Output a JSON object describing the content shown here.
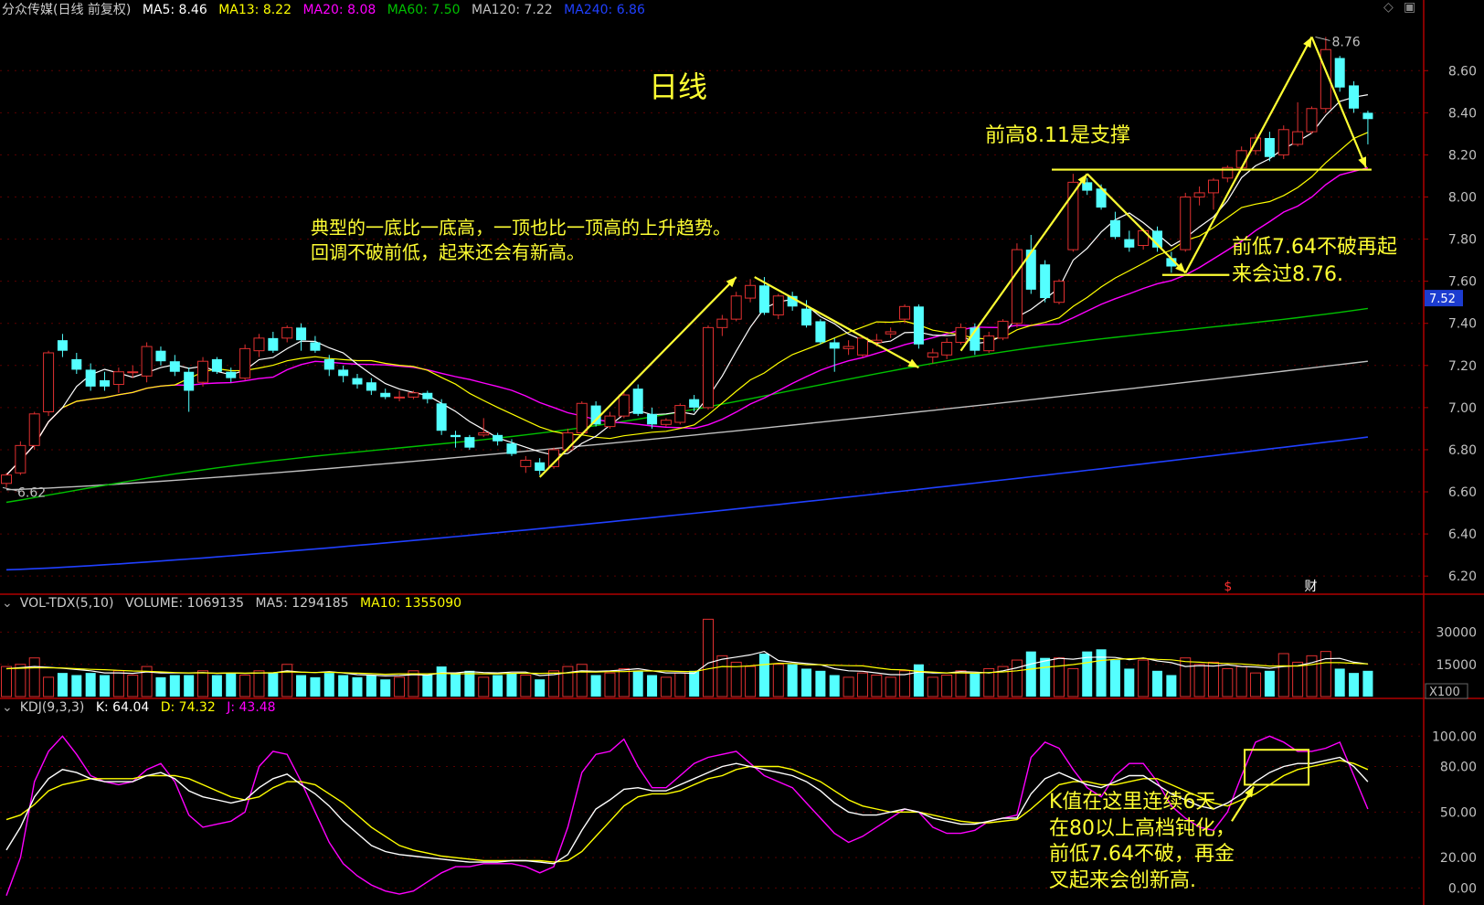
{
  "colors": {
    "background": "#000000",
    "up": "#e03030",
    "down": "#54ffff",
    "ma5": "#ffffff",
    "ma13": "#ffff00",
    "ma20": "#ff00ff",
    "ma60": "#00c000",
    "ma120": "#c0c0c0",
    "ma240": "#2040ff",
    "annotation": "#ffff33",
    "axis": "#b00000"
  },
  "header": {
    "title": "分众传媒(日线 前复权)",
    "ma5": "MA5: 8.46",
    "ma13": "MA13: 8.22",
    "ma20": "MA20: 8.08",
    "ma60": "MA60: 7.50",
    "ma120": "MA120: 7.22",
    "ma240": "MA240: 6.86"
  },
  "vol_header": {
    "name": "VOL-TDX(5,10)",
    "volume": "VOLUME: 1069135",
    "ma5": "MA5: 1294185",
    "ma10": "MA10: 1355090"
  },
  "kdj_header": {
    "name": "KDJ(9,3,3)",
    "k": "K: 64.04",
    "d": "D: 74.32",
    "j": "J: 43.48"
  },
  "annotations": {
    "period": "日线",
    "trend_line1": "典型的一底比一底高，一顶也比一顶高的上升趋势。",
    "trend_line2": "回调不破前低，起来还会有新高。",
    "support": "前高8.11是支撑",
    "low_line1": "前低7.64不破再起",
    "low_line2": "来会过8.76.",
    "kdj_line1": "K值在这里连续6天",
    "kdj_line2": "在80以上高档钝化，",
    "kdj_line3": "前低7.64不破，再金",
    "kdj_line4": "叉起来会创新高."
  },
  "price_labels": {
    "high": "8.76",
    "low": "6.62",
    "current": "7.52"
  },
  "event_markers": [
    "$",
    "财"
  ],
  "chart_data": {
    "type": "candlestick",
    "series_names": [
      "MA5",
      "MA13",
      "MA20",
      "MA60",
      "MA120",
      "MA240"
    ],
    "price_axis": {
      "ticks": [
        8.6,
        8.4,
        8.2,
        8.0,
        7.8,
        7.6,
        7.4,
        7.2,
        7.0,
        6.8,
        6.6,
        6.4,
        6.2
      ],
      "range": [
        6.14,
        8.84
      ]
    },
    "volume_axis": {
      "ticks": [
        30000,
        15000
      ],
      "unit": "X100",
      "range": [
        0,
        40000
      ]
    },
    "kdj_axis": {
      "ticks": [
        100.0,
        80.0,
        50.0,
        20.0,
        0.0
      ],
      "range": [
        -10,
        114
      ]
    },
    "candles": [
      {
        "o": 6.64,
        "h": 6.69,
        "l": 6.62,
        "c": 6.68
      },
      {
        "o": 6.69,
        "h": 6.84,
        "l": 6.68,
        "c": 6.82
      },
      {
        "o": 6.82,
        "h": 6.98,
        "l": 6.8,
        "c": 6.97
      },
      {
        "o": 6.98,
        "h": 7.27,
        "l": 6.96,
        "c": 7.26
      },
      {
        "o": 7.32,
        "h": 7.35,
        "l": 7.24,
        "c": 7.27
      },
      {
        "o": 7.23,
        "h": 7.26,
        "l": 7.16,
        "c": 7.18
      },
      {
        "o": 7.18,
        "h": 7.21,
        "l": 7.08,
        "c": 7.1
      },
      {
        "o": 7.13,
        "h": 7.17,
        "l": 7.08,
        "c": 7.1
      },
      {
        "o": 7.11,
        "h": 7.19,
        "l": 7.07,
        "c": 7.17
      },
      {
        "o": 7.17,
        "h": 7.2,
        "l": 7.14,
        "c": 7.17
      },
      {
        "o": 7.15,
        "h": 7.31,
        "l": 7.12,
        "c": 7.29
      },
      {
        "o": 7.27,
        "h": 7.29,
        "l": 7.2,
        "c": 7.22
      },
      {
        "o": 7.22,
        "h": 7.25,
        "l": 7.15,
        "c": 7.17
      },
      {
        "o": 7.17,
        "h": 7.19,
        "l": 6.98,
        "c": 7.08
      },
      {
        "o": 7.12,
        "h": 7.24,
        "l": 7.1,
        "c": 7.22
      },
      {
        "o": 7.23,
        "h": 7.24,
        "l": 7.16,
        "c": 7.17
      },
      {
        "o": 7.17,
        "h": 7.19,
        "l": 7.12,
        "c": 7.14
      },
      {
        "o": 7.14,
        "h": 7.3,
        "l": 7.13,
        "c": 7.28
      },
      {
        "o": 7.27,
        "h": 7.35,
        "l": 7.24,
        "c": 7.33
      },
      {
        "o": 7.33,
        "h": 7.36,
        "l": 7.26,
        "c": 7.27
      },
      {
        "o": 7.33,
        "h": 7.39,
        "l": 7.31,
        "c": 7.38
      },
      {
        "o": 7.38,
        "h": 7.4,
        "l": 7.27,
        "c": 7.32
      },
      {
        "o": 7.31,
        "h": 7.34,
        "l": 7.26,
        "c": 7.27
      },
      {
        "o": 7.23,
        "h": 7.25,
        "l": 7.15,
        "c": 7.18
      },
      {
        "o": 7.18,
        "h": 7.2,
        "l": 7.12,
        "c": 7.15
      },
      {
        "o": 7.14,
        "h": 7.16,
        "l": 7.09,
        "c": 7.11
      },
      {
        "o": 7.12,
        "h": 7.14,
        "l": 7.06,
        "c": 7.08
      },
      {
        "o": 7.07,
        "h": 7.09,
        "l": 7.04,
        "c": 7.05
      },
      {
        "o": 7.05,
        "h": 7.08,
        "l": 7.03,
        "c": 7.05
      },
      {
        "o": 7.05,
        "h": 7.08,
        "l": 7.04,
        "c": 7.07
      },
      {
        "o": 7.07,
        "h": 7.08,
        "l": 7.02,
        "c": 7.04
      },
      {
        "o": 7.02,
        "h": 7.04,
        "l": 6.87,
        "c": 6.89
      },
      {
        "o": 6.87,
        "h": 6.89,
        "l": 6.81,
        "c": 6.86
      },
      {
        "o": 6.86,
        "h": 6.87,
        "l": 6.8,
        "c": 6.81
      },
      {
        "o": 6.87,
        "h": 6.95,
        "l": 6.86,
        "c": 6.88
      },
      {
        "o": 6.87,
        "h": 6.88,
        "l": 6.82,
        "c": 6.84
      },
      {
        "o": 6.83,
        "h": 6.85,
        "l": 6.77,
        "c": 6.78
      },
      {
        "o": 6.72,
        "h": 6.77,
        "l": 6.69,
        "c": 6.75
      },
      {
        "o": 6.74,
        "h": 6.76,
        "l": 6.68,
        "c": 6.7
      },
      {
        "o": 6.72,
        "h": 6.81,
        "l": 6.71,
        "c": 6.8
      },
      {
        "o": 6.8,
        "h": 6.9,
        "l": 6.79,
        "c": 6.88
      },
      {
        "o": 6.88,
        "h": 7.03,
        "l": 6.87,
        "c": 7.02
      },
      {
        "o": 7.01,
        "h": 7.03,
        "l": 6.91,
        "c": 6.92
      },
      {
        "o": 6.91,
        "h": 6.98,
        "l": 6.9,
        "c": 6.96
      },
      {
        "o": 6.96,
        "h": 7.08,
        "l": 6.95,
        "c": 7.06
      },
      {
        "o": 7.09,
        "h": 7.11,
        "l": 6.96,
        "c": 6.97
      },
      {
        "o": 6.97,
        "h": 7.0,
        "l": 6.9,
        "c": 6.92
      },
      {
        "o": 6.92,
        "h": 6.95,
        "l": 6.91,
        "c": 6.94
      },
      {
        "o": 6.93,
        "h": 7.02,
        "l": 6.92,
        "c": 7.01
      },
      {
        "o": 7.04,
        "h": 7.06,
        "l": 6.98,
        "c": 7.0
      },
      {
        "o": 7.0,
        "h": 7.39,
        "l": 6.99,
        "c": 7.38
      },
      {
        "o": 7.38,
        "h": 7.44,
        "l": 7.34,
        "c": 7.42
      },
      {
        "o": 7.42,
        "h": 7.55,
        "l": 7.41,
        "c": 7.53
      },
      {
        "o": 7.52,
        "h": 7.61,
        "l": 7.5,
        "c": 7.58
      },
      {
        "o": 7.58,
        "h": 7.62,
        "l": 7.44,
        "c": 7.45
      },
      {
        "o": 7.44,
        "h": 7.54,
        "l": 7.42,
        "c": 7.53
      },
      {
        "o": 7.53,
        "h": 7.55,
        "l": 7.46,
        "c": 7.48
      },
      {
        "o": 7.47,
        "h": 7.51,
        "l": 7.38,
        "c": 7.39
      },
      {
        "o": 7.41,
        "h": 7.42,
        "l": 7.3,
        "c": 7.31
      },
      {
        "o": 7.31,
        "h": 7.33,
        "l": 7.17,
        "c": 7.28
      },
      {
        "o": 7.28,
        "h": 7.32,
        "l": 7.25,
        "c": 7.29
      },
      {
        "o": 7.25,
        "h": 7.34,
        "l": 7.24,
        "c": 7.33
      },
      {
        "o": 7.31,
        "h": 7.35,
        "l": 7.29,
        "c": 7.32
      },
      {
        "o": 7.35,
        "h": 7.38,
        "l": 7.33,
        "c": 7.36
      },
      {
        "o": 7.42,
        "h": 7.49,
        "l": 7.4,
        "c": 7.48
      },
      {
        "o": 7.48,
        "h": 7.49,
        "l": 7.28,
        "c": 7.3
      },
      {
        "o": 7.24,
        "h": 7.28,
        "l": 7.21,
        "c": 7.26
      },
      {
        "o": 7.25,
        "h": 7.33,
        "l": 7.23,
        "c": 7.31
      },
      {
        "o": 7.31,
        "h": 7.4,
        "l": 7.3,
        "c": 7.38
      },
      {
        "o": 7.38,
        "h": 7.4,
        "l": 7.25,
        "c": 7.27
      },
      {
        "o": 7.27,
        "h": 7.36,
        "l": 7.26,
        "c": 7.34
      },
      {
        "o": 7.33,
        "h": 7.42,
        "l": 7.32,
        "c": 7.41
      },
      {
        "o": 7.4,
        "h": 7.78,
        "l": 7.38,
        "c": 7.75
      },
      {
        "o": 7.75,
        "h": 7.82,
        "l": 7.54,
        "c": 7.56
      },
      {
        "o": 7.68,
        "h": 7.7,
        "l": 7.5,
        "c": 7.52
      },
      {
        "o": 7.5,
        "h": 7.61,
        "l": 7.49,
        "c": 7.6
      },
      {
        "o": 7.75,
        "h": 8.11,
        "l": 7.74,
        "c": 8.07
      },
      {
        "o": 8.07,
        "h": 8.09,
        "l": 8.01,
        "c": 8.03
      },
      {
        "o": 8.04,
        "h": 8.06,
        "l": 7.94,
        "c": 7.95
      },
      {
        "o": 7.89,
        "h": 7.93,
        "l": 7.8,
        "c": 7.81
      },
      {
        "o": 7.8,
        "h": 7.84,
        "l": 7.74,
        "c": 7.76
      },
      {
        "o": 7.77,
        "h": 7.85,
        "l": 7.75,
        "c": 7.84
      },
      {
        "o": 7.84,
        "h": 7.86,
        "l": 7.74,
        "c": 7.76
      },
      {
        "o": 7.71,
        "h": 7.74,
        "l": 7.64,
        "c": 7.67
      },
      {
        "o": 7.75,
        "h": 8.02,
        "l": 7.74,
        "c": 8.0
      },
      {
        "o": 8.0,
        "h": 8.05,
        "l": 7.96,
        "c": 8.02
      },
      {
        "o": 8.02,
        "h": 8.09,
        "l": 7.94,
        "c": 8.08
      },
      {
        "o": 8.09,
        "h": 8.15,
        "l": 8.07,
        "c": 8.14
      },
      {
        "o": 8.14,
        "h": 8.24,
        "l": 8.13,
        "c": 8.22
      },
      {
        "o": 8.22,
        "h": 8.3,
        "l": 8.2,
        "c": 8.28
      },
      {
        "o": 8.28,
        "h": 8.31,
        "l": 8.17,
        "c": 8.19
      },
      {
        "o": 8.2,
        "h": 8.34,
        "l": 8.18,
        "c": 8.32
      },
      {
        "o": 8.25,
        "h": 8.45,
        "l": 8.24,
        "c": 8.31
      },
      {
        "o": 8.31,
        "h": 8.43,
        "l": 8.3,
        "c": 8.42
      },
      {
        "o": 8.42,
        "h": 8.76,
        "l": 8.4,
        "c": 8.7
      },
      {
        "o": 8.66,
        "h": 8.67,
        "l": 8.5,
        "c": 8.52
      },
      {
        "o": 8.53,
        "h": 8.55,
        "l": 8.4,
        "c": 8.42
      },
      {
        "o": 8.4,
        "h": 8.41,
        "l": 8.25,
        "c": 8.37
      }
    ],
    "volumes": [
      14,
      15,
      18,
      9,
      11,
      10,
      11,
      10,
      12,
      10,
      14,
      9,
      10,
      10,
      12,
      10,
      11,
      10,
      12,
      11,
      15,
      10,
      9,
      11,
      10,
      9,
      10,
      8,
      9,
      12,
      10,
      14,
      11,
      12,
      9,
      10,
      11,
      10,
      8,
      12,
      14,
      15,
      10,
      11,
      13,
      12,
      10,
      9,
      11,
      12,
      36,
      19,
      16,
      14,
      20,
      15,
      15,
      13,
      12,
      10,
      9,
      11,
      10,
      9,
      12,
      15,
      9,
      10,
      12,
      11,
      13,
      14,
      17,
      21,
      18,
      18,
      13,
      21,
      22,
      17,
      13,
      17,
      12,
      10,
      18,
      15,
      16,
      13,
      14,
      11,
      12,
      20,
      16,
      19,
      21,
      13,
      11,
      12
    ],
    "vol_ma5": [
      13,
      13.5,
      14,
      13.6,
      13.2,
      12.6,
      12,
      11,
      11,
      10.8,
      11.5,
      11,
      11,
      11,
      11.2,
      10.8,
      11,
      10.8,
      11,
      11,
      12,
      11.4,
      11.2,
      11.6,
      11,
      10.2,
      10,
      9.6,
      9.8,
      10.2,
      10,
      11,
      11,
      11.6,
      11.2,
      11,
      11.4,
      11.4,
      9.8,
      10.2,
      11.2,
      12,
      11.8,
      12,
      12.4,
      13,
      12,
      11,
      11,
      10.8,
      15.6,
      17.4,
      18.4,
      19.4,
      21,
      16.8,
      16,
      15.4,
      14.8,
      13,
      12,
      11.8,
      11,
      10.2,
      10.2,
      11.4,
      11,
      11,
      11.6,
      11.4,
      11,
      12,
      13.4,
      15.2,
      16.6,
      17.8,
      17.4,
      18.2,
      18.4,
      18.2,
      17.2,
      18,
      16.6,
      15.8,
      14,
      14.4,
      14.2,
      14.8,
      14,
      13.8,
      13.2,
      14,
      14.4,
      15.8,
      17.6,
      17.8,
      16,
      15.2
    ],
    "vol_ma10": [
      13,
      13.2,
      13.4,
      13.4,
      13.3,
      13,
      12.7,
      12.5,
      12.2,
      11.9,
      11.8,
      11.5,
      11.2,
      11,
      11,
      10.9,
      11,
      10.9,
      11,
      11.1,
      11.5,
      11.3,
      11.2,
      11.3,
      11.1,
      10.9,
      10.7,
      10.4,
      10.6,
      10.6,
      10.6,
      10.8,
      10.6,
      10.7,
      10.6,
      10.6,
      10.8,
      10.9,
      10.8,
      10.9,
      11,
      11.5,
      11.4,
      11.6,
      11.6,
      11.9,
      11.9,
      11.9,
      11.7,
      11.6,
      12.9,
      14,
      13.9,
      14.3,
      14.9,
      15.5,
      15.4,
      14.8,
      14.8,
      14.6,
      14.4,
      14.3,
      13.4,
      12.6,
      12.4,
      11.7,
      11.4,
      11,
      11,
      10.9,
      11.2,
      11.5,
      12,
      12.8,
      13.6,
      14.2,
      14.9,
      15.8,
      16.8,
      17.3,
      17.6,
      17.8,
      17.3,
      17.1,
      16.3,
      16,
      15.6,
      15.4,
      15.2,
      14.7,
      14.2,
      14.3,
      14.2,
      14.9,
      15.8,
      15.8,
      15.5,
      15.2
    ],
    "kdj": {
      "k": [
        25,
        40,
        60,
        72,
        78,
        76,
        72,
        70,
        70,
        70,
        74,
        76,
        72,
        64,
        60,
        58,
        56,
        58,
        66,
        72,
        75,
        68,
        62,
        54,
        44,
        36,
        28,
        24,
        22,
        21,
        20,
        19,
        18,
        17,
        17,
        17,
        18,
        18,
        17,
        16,
        22,
        38,
        52,
        58,
        65,
        66,
        64,
        64,
        68,
        72,
        76,
        80,
        82,
        80,
        78,
        76,
        74,
        70,
        64,
        56,
        50,
        48,
        48,
        50,
        52,
        50,
        46,
        44,
        42,
        42,
        44,
        46,
        46,
        62,
        72,
        76,
        72,
        68,
        66,
        70,
        74,
        74,
        68,
        62,
        58,
        54,
        52,
        56,
        62,
        70,
        76,
        80,
        82,
        82,
        84,
        86,
        80,
        70
      ],
      "d": [
        45,
        48,
        55,
        64,
        68,
        70,
        72,
        72,
        72,
        72,
        74,
        74,
        74,
        72,
        68,
        64,
        60,
        58,
        60,
        66,
        70,
        70,
        68,
        62,
        56,
        48,
        40,
        34,
        28,
        25,
        23,
        21,
        20,
        19,
        18,
        18,
        18,
        18,
        18,
        17,
        18,
        24,
        34,
        44,
        54,
        60,
        62,
        62,
        64,
        68,
        72,
        74,
        78,
        80,
        80,
        80,
        78,
        74,
        70,
        64,
        58,
        54,
        52,
        50,
        50,
        50,
        48,
        46,
        44,
        43,
        43,
        44,
        45,
        52,
        60,
        68,
        70,
        70,
        68,
        68,
        70,
        72,
        72,
        68,
        64,
        60,
        56,
        54,
        58,
        62,
        68,
        74,
        78,
        80,
        82,
        84,
        82,
        78
      ],
      "j": [
        -5,
        20,
        70,
        90,
        100,
        88,
        74,
        70,
        68,
        70,
        78,
        82,
        70,
        48,
        40,
        42,
        44,
        50,
        80,
        90,
        88,
        70,
        50,
        30,
        16,
        8,
        2,
        -2,
        -4,
        -2,
        4,
        10,
        14,
        14,
        16,
        16,
        16,
        14,
        10,
        14,
        40,
        76,
        88,
        90,
        98,
        80,
        66,
        66,
        74,
        82,
        86,
        88,
        90,
        82,
        74,
        70,
        66,
        56,
        46,
        36,
        30,
        34,
        40,
        46,
        52,
        50,
        40,
        36,
        36,
        38,
        44,
        46,
        48,
        86,
        96,
        92,
        78,
        66,
        60,
        74,
        82,
        82,
        70,
        54,
        46,
        40,
        38,
        50,
        74,
        96,
        100,
        96,
        90,
        90,
        92,
        96,
        74,
        52
      ]
    }
  }
}
